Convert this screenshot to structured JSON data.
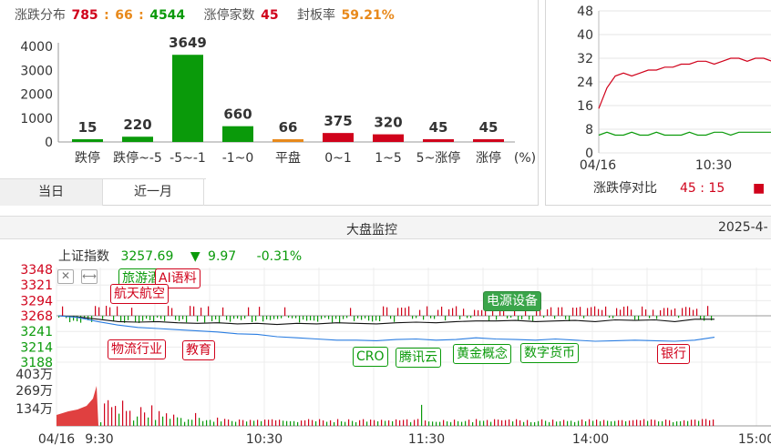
{
  "distribution": {
    "label": "涨跌分布",
    "up": "785",
    "sep1": ":",
    "flat": "66",
    "sep2": ":",
    "down": "4544",
    "limit_up_label": "涨停家数",
    "limit_up_count": "45",
    "seal_rate_label": "封板率",
    "seal_rate": "59.21%"
  },
  "chart_data": [
    {
      "type": "bar",
      "categories": [
        "跌停",
        "跌停~-5",
        "-5~-1",
        "-1~0",
        "平盘",
        "0~1",
        "1~5",
        "5~涨停",
        "涨停"
      ],
      "values": [
        15,
        220,
        3649,
        660,
        66,
        375,
        320,
        45,
        45
      ],
      "value_labels": [
        "15",
        "220",
        "3649",
        "660",
        "66",
        "375",
        "320",
        "45",
        "45"
      ],
      "unit_label": "(%)",
      "y_ticks": [
        "4000",
        "3000",
        "2000",
        "1000",
        "0"
      ],
      "ylim": [
        0,
        4000
      ],
      "colors": [
        "#0a9a0a",
        "#0a9a0a",
        "#0a9a0a",
        "#0a9a0a",
        "#e8891b",
        "#d0021b",
        "#d0021b",
        "#d0021b",
        "#d0021b"
      ]
    },
    {
      "type": "line",
      "y_ticks": [
        "48",
        "40",
        "32",
        "24",
        "16",
        "8",
        "0"
      ],
      "ylim": [
        0,
        48
      ],
      "x_ticks": [
        "04/16",
        "10:30"
      ],
      "series": [
        {
          "color": "#d0021b",
          "values": [
            15,
            22,
            26,
            27,
            26,
            27,
            28,
            28,
            29,
            29,
            30,
            30,
            31,
            31,
            30,
            31,
            32,
            32,
            31,
            32,
            32,
            31
          ]
        },
        {
          "color": "#0a9a0a",
          "values": [
            6,
            7,
            6,
            6,
            7,
            6,
            6,
            7,
            6,
            6,
            6,
            7,
            6,
            6,
            7,
            7,
            6,
            7,
            7,
            7,
            7,
            7
          ]
        }
      ],
      "legend_label": "涨跌停对比",
      "legend_value": "45 : 15"
    },
    {
      "type": "line",
      "y_ticks_red": [
        "3348",
        "3321",
        "3294",
        "3268"
      ],
      "y_ticks_green": [
        "3241",
        "3214",
        "3188"
      ],
      "ylim": [
        3188,
        3348
      ],
      "series": [
        {
          "color": "#111111",
          "values": [
            3268,
            3266,
            3262,
            3258,
            3257,
            3258,
            3256,
            3255,
            3256,
            3254,
            3255,
            3253,
            3255,
            3254,
            3256,
            3255,
            3254,
            3256,
            3257,
            3256,
            3258,
            3259,
            3259,
            3260,
            3258,
            3259,
            3260,
            3258,
            3261,
            3260,
            3261,
            3258,
            3262,
            3262
          ]
        },
        {
          "color": "#2a7de1",
          "values": [
            3268,
            3265,
            3258,
            3252,
            3248,
            3246,
            3244,
            3242,
            3240,
            3237,
            3236,
            3232,
            3230,
            3228,
            3226,
            3226,
            3225,
            3227,
            3228,
            3226,
            3227,
            3230,
            3228,
            3227,
            3226,
            3228,
            3226,
            3224,
            3225,
            3226,
            3225,
            3224,
            3226,
            3231
          ]
        }
      ],
      "volume_ticks": [
        "403万",
        "269万",
        "134万"
      ],
      "time_ticks": [
        "04/16",
        "9:30",
        "10:30",
        "11:30",
        "14:00",
        "15:00"
      ]
    }
  ],
  "tabs": [
    {
      "label": "当日",
      "active": true
    },
    {
      "label": "近一月",
      "active": false
    }
  ],
  "monitor": {
    "title": "大盘监控",
    "date": "2025-4-",
    "index_name": "上证指数",
    "index_value": "3257.69",
    "arrow": "▼",
    "change": "9.97",
    "change_pct": "-0.31%",
    "legend_marker": "■"
  },
  "tags": {
    "t1": "旅游酒",
    "t2": "AI语料",
    "t3": "航天航空",
    "t4": "电源设备",
    "t5": "物流行业",
    "t6": "教育",
    "t7": "CRO",
    "t8": "腾讯云",
    "t9": "黄金概念",
    "t10": "数字货币",
    "t11": "银行"
  },
  "icons": {
    "close": "close-icon",
    "expand": "expand-icon"
  }
}
